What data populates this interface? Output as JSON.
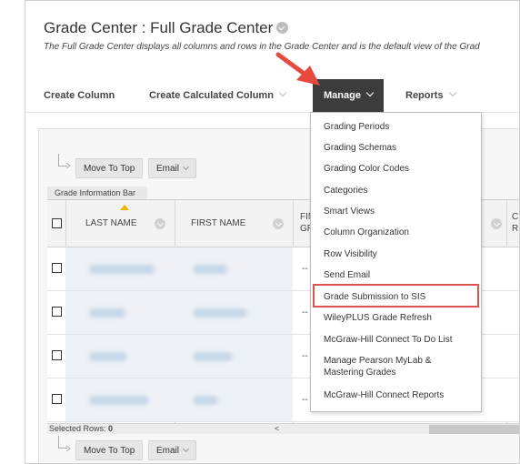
{
  "page": {
    "title": "Grade Center : Full Grade Center",
    "description": "The Full Grade Center displays all columns and rows in the Grade Center and is the default view of the Grad"
  },
  "menubar": {
    "create_column": "Create Column",
    "create_calculated_column": "Create Calculated Column",
    "manage": "Manage",
    "reports": "Reports"
  },
  "actions": {
    "move_to_top": "Move To Top",
    "email": "Email"
  },
  "grid": {
    "info_bar": "Grade Information Bar",
    "headers": {
      "last_name": "LAST NAME",
      "first_name": "FIRST NAME",
      "col3_line1": "FIN",
      "col3_line2": "GR",
      "col4_line1": "C",
      "col4_line2": "R"
    },
    "rows": [
      {
        "value": "--"
      },
      {
        "value": "--"
      },
      {
        "value": "--"
      },
      {
        "value": "--"
      }
    ],
    "selected_rows_label": "Selected Rows:",
    "selected_rows_count": "0",
    "scroll_left": "<"
  },
  "manage_menu": {
    "items": [
      "Grading Periods",
      "Grading Schemas",
      "Grading Color Codes",
      "Categories",
      "Smart Views",
      "Column Organization",
      "Row Visibility",
      "Send Email",
      "Grade Submission to SIS",
      "WileyPLUS Grade Refresh",
      "McGraw-Hill Connect To Do List",
      "Manage Pearson MyLab &",
      "Mastering Grades",
      "McGraw-Hill Connect Reports"
    ],
    "highlighted_item": "Grade Submission to SIS"
  },
  "colors": {
    "manage_active_bg": "#3c3c3c",
    "highlight_border": "#d9534f",
    "arrow": "#e64a3c",
    "sort_arrow": "#f0b400"
  }
}
